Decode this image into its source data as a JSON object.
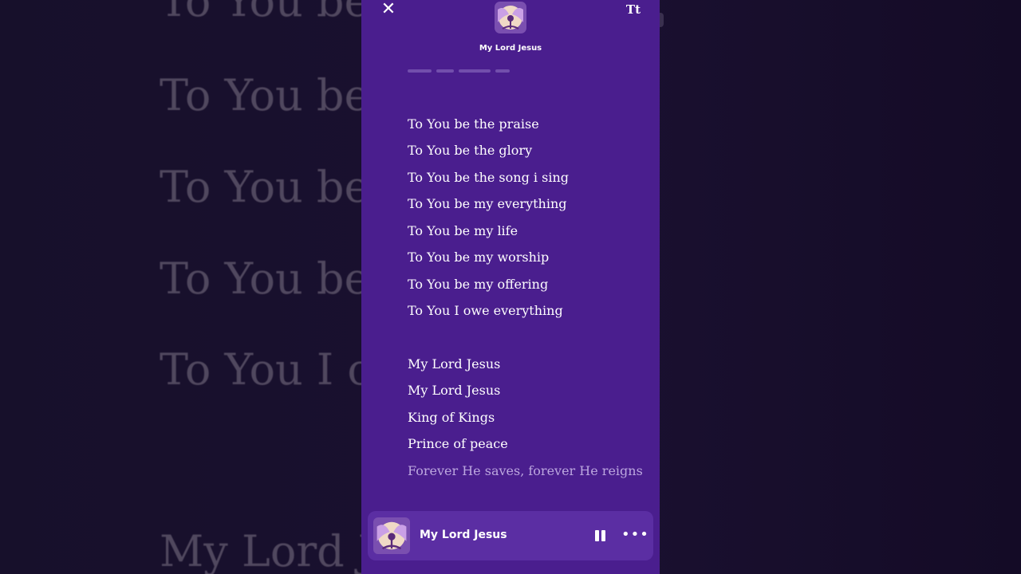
{
  "background_lyrics": [
    "To You be",
    "To You be",
    "To You be",
    "To You be",
    "To You I ow",
    "My Lord Jes"
  ],
  "header": {
    "close_icon": "close-icon",
    "text_size_label": "Tt",
    "song_title": "My Lord Jesus"
  },
  "lyrics": [
    {
      "text": "To You be the praise"
    },
    {
      "text": "To You be the glory"
    },
    {
      "text": "To You be the song i sing"
    },
    {
      "text": "To You be my everything"
    },
    {
      "text": "To You be my life"
    },
    {
      "text": "To You be my worship"
    },
    {
      "text": "To You be my offering"
    },
    {
      "text": "To You I owe everything"
    },
    {
      "text": "My Lord Jesus"
    },
    {
      "text": "My Lord Jesus"
    },
    {
      "text": "King of Kings"
    },
    {
      "text": "Prince of peace"
    },
    {
      "text": "Forever He saves, forever He reigns",
      "dim": true
    }
  ],
  "player": {
    "title": "My Lord Jesus",
    "pause_icon": "pause-icon",
    "more_icon": "more-icon"
  },
  "colors": {
    "panel": "#4a1e8e",
    "player": "#5b2ea3",
    "lyric": "#ffffff",
    "lyric_upcoming": "#bca7df"
  }
}
